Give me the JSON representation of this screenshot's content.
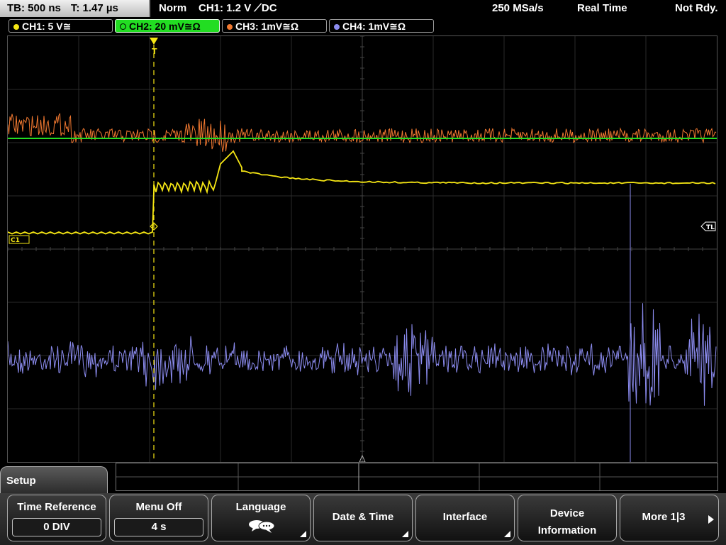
{
  "status": {
    "timebase": "TB: 500 ns",
    "trigger_time": "T: 1.47 µs",
    "trigger_mode": "Norm",
    "trigger_source": "CH1: 1.2 V ⟋DC",
    "sample_rate": "250 MSa/s",
    "acq_mode": "Real Time",
    "state": "Not Rdy."
  },
  "channels": [
    {
      "label": "CH1: 5 V≅",
      "color": "#f5e614",
      "active": false
    },
    {
      "label": "CH2: 20 mV≅Ω",
      "color": "#22dd22",
      "active": true
    },
    {
      "label": "CH3: 1mV≅Ω",
      "color": "#f07830",
      "active": false
    },
    {
      "label": "CH4: 1mV≅Ω",
      "color": "#8c8cf0",
      "active": false
    }
  ],
  "markers": {
    "ch1_ground": "C1",
    "trigger_level": "TL",
    "trigger_pos": "T"
  },
  "menu": {
    "title": "Setup",
    "softkeys": [
      {
        "label": "Time Reference",
        "value": "0 DIV"
      },
      {
        "label": "Menu Off",
        "value": "4 s"
      },
      {
        "label": "Language",
        "icon": "speech-bubbles-icon"
      },
      {
        "label": "Date & Time"
      },
      {
        "label": "Interface"
      },
      {
        "label_line1": "Device",
        "label_line2": "Information"
      },
      {
        "label": "More 1|3"
      }
    ]
  }
}
